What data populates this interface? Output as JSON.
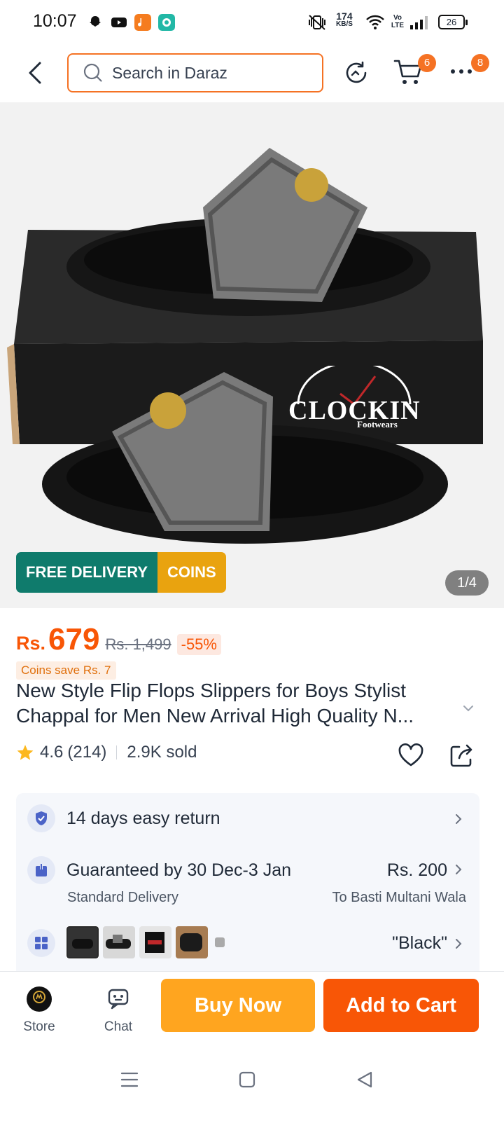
{
  "status_bar": {
    "time": "10:07",
    "speed_value": "174",
    "speed_unit": "KB/S",
    "network": "Vo LTE",
    "battery": "26"
  },
  "header": {
    "search_placeholder": "Search in Daraz",
    "cart_count": "6",
    "more_count": "8"
  },
  "gallery": {
    "free_delivery": "FREE DELIVERY",
    "coins": "COINS",
    "counter": "1/4",
    "box_brand": "CLOCKIN",
    "box_sub": "Footwears"
  },
  "product": {
    "currency": "Rs.",
    "price": "679",
    "original_price": "Rs. 1,499",
    "discount": "-55%",
    "coins_save": "Coins save Rs. 7",
    "title_line1": "New Style Flip Flops Slippers for Boys Stylist",
    "title_line2": "Chappal for Men New Arrival High Quality N...",
    "rating": "4.6",
    "reviews": "(214)",
    "sold": "2.9K sold"
  },
  "service": {
    "return": "14 days easy return",
    "delivery": "Guaranteed by 30 Dec-3 Jan",
    "delivery_type": "Standard Delivery",
    "delivery_fee": "Rs. 200",
    "delivery_to": "To Basti Multani Wala",
    "variant": "\"Black\""
  },
  "bottom_bar": {
    "store": "Store",
    "chat": "Chat",
    "buy_now": "Buy Now",
    "add_to_cart": "Add to Cart"
  },
  "colors": {
    "accent": "#f85606",
    "buy_now": "#ffa51f",
    "free_delivery": "#0f7b6c",
    "coins": "#e9a30f"
  }
}
